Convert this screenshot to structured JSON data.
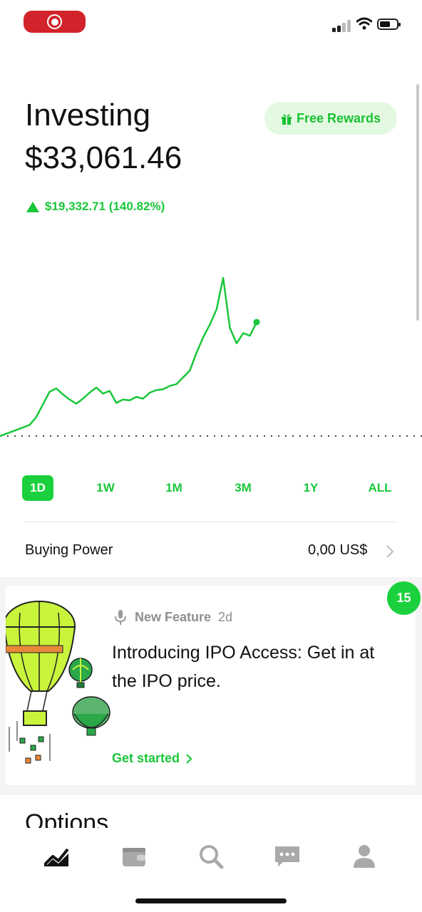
{
  "status_bar": {
    "record_icon": "record-icon",
    "signal_icon": "cellular-signal-icon",
    "wifi_icon": "wifi-icon",
    "battery_icon": "battery-icon"
  },
  "header": {
    "title": "Investing",
    "balance": "$33,061.46",
    "rewards_label": "Free Rewards",
    "rewards_icon": "gift-icon",
    "change": "$19,332.71 (140.82%)",
    "change_icon": "triangle-up-icon"
  },
  "chart_data": {
    "type": "line",
    "title": "",
    "xlabel": "",
    "ylabel": "",
    "color": "#19c73a",
    "baseline_style": "dotted",
    "y": [
      1.0,
      1.3,
      2.2,
      3.7,
      5.2,
      5.6,
      4.9,
      4.3,
      3.8,
      4.4,
      5.1,
      5.7,
      5.0,
      5.3,
      3.9,
      4.3,
      4.2,
      4.6,
      4.4,
      5.1,
      5.4,
      5.5,
      5.9,
      6.1,
      6.9,
      7.7,
      9.8,
      11.6,
      13.1,
      14.9,
      18.6,
      12.7,
      10.9,
      12.1,
      11.8,
      13.4
    ]
  },
  "time_ranges": [
    {
      "label": "1D",
      "active": true
    },
    {
      "label": "1W",
      "active": false
    },
    {
      "label": "1M",
      "active": false
    },
    {
      "label": "3M",
      "active": false
    },
    {
      "label": "1Y",
      "active": false
    },
    {
      "label": "ALL",
      "active": false
    }
  ],
  "buying_power": {
    "label": "Buying Power",
    "value": "0,00 US$",
    "chevron_icon": "chevron-right-icon"
  },
  "feature_card": {
    "badge": "15",
    "tag_icon": "microphone-icon",
    "tag": "New Feature",
    "time": "2d",
    "title": "Introducing IPO Access: Get in at the IPO price.",
    "cta": "Get started",
    "cta_icon": "chevron-right-icon",
    "illustration": "hot-air-balloons-illustration",
    "colors": {
      "balloon": "#c8f53c",
      "accent": "#19c73a"
    }
  },
  "next_section": {
    "title": "Options"
  },
  "tab_bar": [
    {
      "name": "investing-tab",
      "icon": "chart-icon",
      "active": true
    },
    {
      "name": "wallet-tab",
      "icon": "wallet-icon",
      "active": false
    },
    {
      "name": "search-tab",
      "icon": "search-icon",
      "active": false
    },
    {
      "name": "messages-tab",
      "icon": "chat-icon",
      "active": false
    },
    {
      "name": "account-tab",
      "icon": "person-icon",
      "active": false
    }
  ],
  "colors": {
    "accent": "#19c73a",
    "accent_button": "#1ad13d",
    "inactive_icon": "#a9a9a9",
    "rewards_bg": "#e4f9e2"
  }
}
